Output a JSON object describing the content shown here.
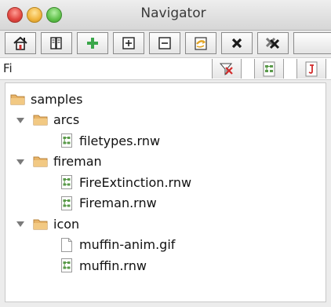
{
  "window": {
    "title": "Navigator"
  },
  "toolbar": {
    "buttons": [
      {
        "name": "home-button",
        "icon": "home-icon"
      },
      {
        "name": "book-button",
        "icon": "book-icon"
      },
      {
        "name": "add-button",
        "icon": "green-plus-icon"
      },
      {
        "name": "expand-all-button",
        "icon": "boxed-plus-icon"
      },
      {
        "name": "collapse-all-button",
        "icon": "boxed-minus-icon"
      },
      {
        "name": "refresh-button",
        "icon": "folder-arrow-icon"
      },
      {
        "name": "close-button",
        "icon": "close-x-icon"
      },
      {
        "name": "close-all-button",
        "icon": "double-x-icon"
      }
    ]
  },
  "filter": {
    "value": "Fi",
    "buttons": [
      {
        "name": "clear-filter-button",
        "icon": "filter-clear-icon"
      },
      {
        "name": "rnw-filter-button",
        "icon": "rnw-file-icon"
      },
      {
        "name": "java-filter-button",
        "icon": "java-file-icon"
      }
    ]
  },
  "tree": {
    "items": [
      {
        "label": "samples",
        "type": "folder",
        "depth": 0,
        "expanded": true,
        "toggle": false
      },
      {
        "label": "arcs",
        "type": "folder",
        "depth": 1,
        "expanded": true,
        "toggle": true
      },
      {
        "label": "filetypes.rnw",
        "type": "rnw",
        "depth": 2
      },
      {
        "label": "fireman",
        "type": "folder",
        "depth": 1,
        "expanded": true,
        "toggle": true
      },
      {
        "label": "FireExtinction.rnw",
        "type": "rnw",
        "depth": 2
      },
      {
        "label": "Fireman.rnw",
        "type": "rnw",
        "depth": 2
      },
      {
        "label": "icon",
        "type": "folder",
        "depth": 1,
        "expanded": true,
        "toggle": true
      },
      {
        "label": "muffin-anim.gif",
        "type": "gif",
        "depth": 2
      },
      {
        "label": "muffin.rnw",
        "type": "rnw",
        "depth": 2
      }
    ]
  },
  "colors": {
    "folder": "#e8b468",
    "rnw_icon_green": "#5a9a4a",
    "filter_red": "#d22a2a"
  }
}
